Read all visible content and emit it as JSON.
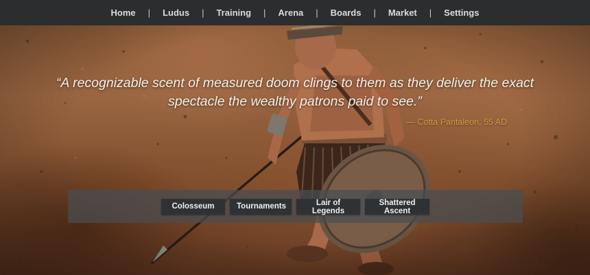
{
  "nav": {
    "items": [
      {
        "label": "Home"
      },
      {
        "label": "Ludus"
      },
      {
        "label": "Training"
      },
      {
        "label": "Arena"
      },
      {
        "label": "Boards"
      },
      {
        "label": "Market"
      },
      {
        "label": "Settings"
      }
    ],
    "separator": "|"
  },
  "quote": {
    "text": "“A recognizable scent of measured doom clings to them as they deliver the exact spectacle the wealthy patrons paid to see.”",
    "attribution": "— Cotta Pantaleon, 55 AD"
  },
  "venues": {
    "buttons": [
      {
        "label": "Colosseum"
      },
      {
        "label": "Tournaments"
      },
      {
        "label": "Lair of Legends"
      },
      {
        "label": "Shattered Ascent"
      }
    ]
  },
  "colors": {
    "nav_bg": "#2b2d2f",
    "nav_text": "#d9dcde",
    "quote_text": "#f4efe8",
    "attribution": "#d39a3e",
    "panel_bg": "#484e52",
    "button_bg": "#2e3235"
  },
  "hero_image": {
    "icon": "gladiator-with-shield-and-spear"
  }
}
